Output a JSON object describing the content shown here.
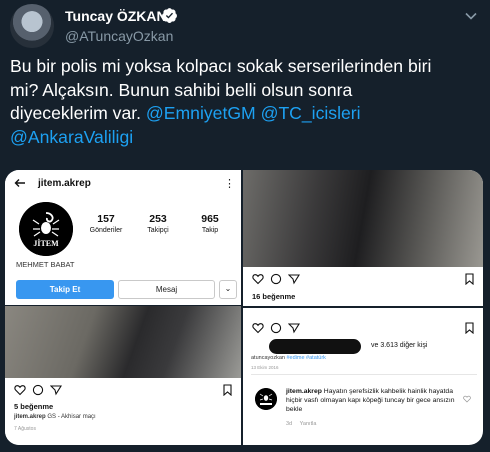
{
  "tweet": {
    "display_name": "Tuncay ÖZKAN",
    "handle": "@ATuncayOzkan",
    "text_line1": "Bu bir polis mi yoksa kolpacı sokak serserilerinden biri",
    "text_line2": "mi? Alçaksın. Bunun sahibi belli olsun sonra",
    "text_line3_plain": "diyeceklerim var.",
    "mention1": "@EmniyetGM",
    "mention2": "@TC_icisleri",
    "mention3": "@AnkaraValiligi"
  },
  "instagram_profile": {
    "username": "jitem.akrep",
    "logo_text": "JİTEM",
    "posts_count": "157",
    "posts_label": "Gönderiler",
    "followers_count": "253",
    "followers_label": "Takipçi",
    "following_count": "965",
    "following_label": "Takip",
    "full_name": "MEHMET BABAT",
    "follow_button": "Takip Et",
    "message_button": "Mesaj",
    "dropdown_icon": "chevron-down"
  },
  "post_bottom_left": {
    "likes": "5 beğenme",
    "caption_user": "jitem.akrep",
    "caption_text": "GS - Akhisar maçı",
    "date": "7 Ağustos"
  },
  "post_top_right": {
    "likes": "16 beğenme"
  },
  "post_bottom_right": {
    "liked_by_suffix": "ve 3.613 diğer kişi",
    "comment_user": "atuncayozkan",
    "comment_tags": "#edime #atatürk",
    "comment_date": "13 Ekim 2016",
    "reply_user": "jitem.akrep",
    "reply_text": "Hayatın şerefsizlik kahbelik hainlik hayatda hiçbir vasfı olmayan kapı köpeği tuncay bir gece ansızın bekle",
    "reply_age": "3d",
    "reply_action": "Yanıtla"
  },
  "colors": {
    "background": "#15202b",
    "mention": "#1da1f2",
    "handle": "#8899a6",
    "ig_follow": "#3897f0"
  }
}
